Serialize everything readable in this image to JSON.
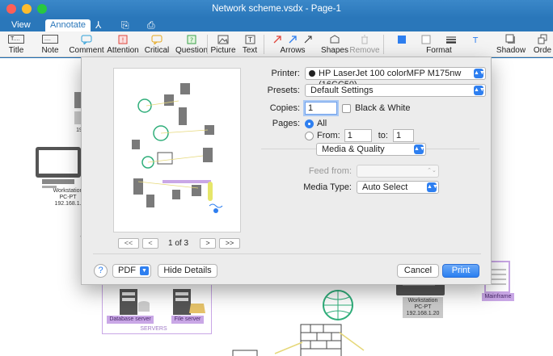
{
  "window": {
    "title": "Network scheme.vsdx - Page-1"
  },
  "tabs": [
    {
      "label": "View"
    },
    {
      "label": "Annotate"
    }
  ],
  "ribbon": {
    "title": "Title",
    "note": "Note",
    "comment": "Comment",
    "attention": "Attention",
    "critical": "Critical",
    "question": "Question",
    "picture": "Picture",
    "text": "Text",
    "arrows": "Arrows",
    "shapes": "Shapes",
    "remove": "Remove",
    "format": "Format",
    "shadow": "Shadow",
    "order": "Orde"
  },
  "canvas": {
    "workstation_left": {
      "line1": "Workstation",
      "line2": "PC-PT",
      "line3": "192.168.1."
    },
    "partial_left": "19",
    "workstation_right": {
      "line1": "Workstation",
      "line2": "PC-PT",
      "line3": "192.168.1.20"
    },
    "mainframe": "Mainframe",
    "database_server": "Database server",
    "file_server": "File server",
    "servers": "SERVERS"
  },
  "dialog": {
    "printer_label": "Printer:",
    "printer_value": "HP LaserJet 100 colorMFP M175nw (16CC50)",
    "presets_label": "Presets:",
    "presets_value": "Default Settings",
    "copies_label": "Copies:",
    "copies_value": "1",
    "bw_label": "Black & White",
    "pages_label": "Pages:",
    "all_label": "All",
    "from_label": "From:",
    "from_value": "1",
    "to_label": "to:",
    "to_value": "1",
    "section_value": "Media & Quality",
    "feed_label": "Feed from:",
    "feed_value": "",
    "media_label": "Media Type:",
    "media_value": "Auto Select",
    "page_indicator": "1 of 3",
    "help": "?",
    "pdf": "PDF",
    "hide_details": "Hide Details",
    "cancel": "Cancel",
    "print": "Print"
  },
  "colors": {
    "accent": "#2a7ff0",
    "titlebar": "#2a77ba",
    "label_purple": "#c9a7e6"
  }
}
